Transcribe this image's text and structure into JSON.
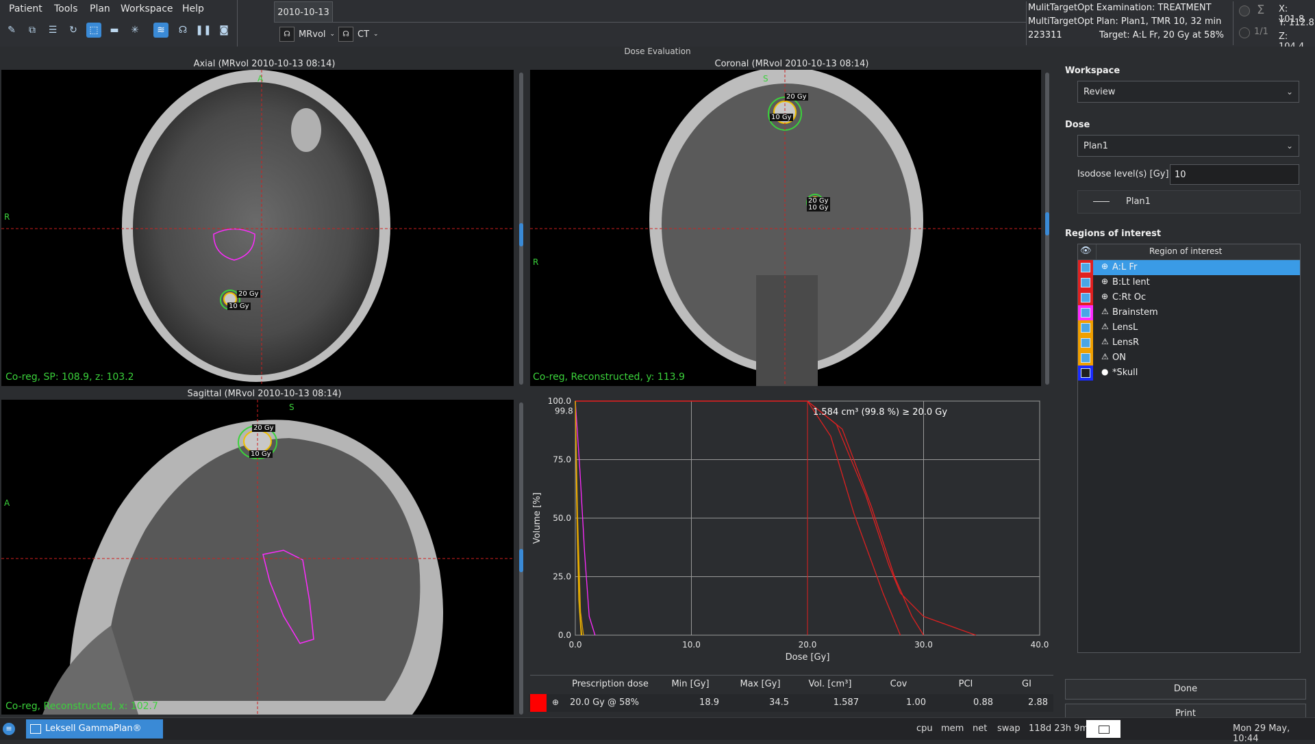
{
  "menu": [
    "Patient",
    "Tools",
    "Plan",
    "Workspace",
    "Help"
  ],
  "dataset": {
    "date_tab": "2010-10-13",
    "primary": "MRvol",
    "secondary": "CT"
  },
  "exam_info": {
    "line1": "MulitTargetOpt Examination: TREATMENT",
    "line2": "MultiTargetOpt Plan: Plan1, TMR 10, 32 min",
    "patient_id": "223311",
    "target": "Target: A:L Fr, 20 Gy at 58%"
  },
  "coords": {
    "x": "X: 101.8",
    "y": "Y: 112.8",
    "z": "Z: 104.4",
    "frames": "1/1"
  },
  "section_title": "Dose Evaluation",
  "views": {
    "axial": {
      "title": "Axial (MRvol 2010-10-13 08:14)",
      "status": "Co-reg, SP: 108.9, z: 103.2",
      "orient_left": "R",
      "orient_top": "A"
    },
    "coronal": {
      "title": "Coronal (MRvol 2010-10-13 08:14)",
      "status": "Co-reg, Reconstructed, y: 113.9",
      "orient_left": "R",
      "orient_top": "S"
    },
    "sagittal": {
      "title": "Sagittal (MRvol 2010-10-13 08:14)",
      "status": "Co-reg, Reconstructed, x: 102.7",
      "orient_left": "A",
      "orient_top": "S"
    },
    "iso_20": "20 Gy",
    "iso_10": "10 Gy"
  },
  "chart_data": {
    "type": "line",
    "xlabel": "Dose [Gy]",
    "ylabel": "Volume [%]",
    "xlim": [
      0,
      40
    ],
    "ylim": [
      0,
      100
    ],
    "x_ticks": [
      "0.0",
      "10.0",
      "20.0",
      "30.0",
      "40.0"
    ],
    "y_ticks": [
      "0.0",
      "25.0",
      "50.0",
      "75.0",
      "100.0"
    ],
    "extra_tick": "99.8",
    "annotation": "1.584 cm³ (99.8 %) ≥ 20.0 Gy",
    "grid": true,
    "series": [
      {
        "color": "#e02020",
        "x": [
          0,
          20.0,
          22.5,
          25.0,
          27.0,
          28.0,
          30.0,
          34.5
        ],
        "y": [
          100,
          100,
          90,
          60,
          30,
          18,
          8,
          0
        ]
      },
      {
        "color": "#e02020",
        "x": [
          0,
          20.0,
          23.0,
          25.5,
          27.5,
          29.0,
          30.0
        ],
        "y": [
          100,
          100,
          88,
          55,
          25,
          8,
          0
        ]
      },
      {
        "color": "#e02020",
        "x": [
          0,
          20.0,
          22.0,
          24.0,
          26.5,
          28.0
        ],
        "y": [
          100,
          100,
          85,
          52,
          18,
          0
        ]
      },
      {
        "color": "#ff2bff",
        "x": [
          0,
          0.4,
          0.8,
          1.2,
          1.7
        ],
        "y": [
          100,
          70,
          35,
          8,
          0
        ]
      },
      {
        "color": "#f0a000",
        "x": [
          0,
          0.1,
          0.3,
          0.5
        ],
        "y": [
          100,
          60,
          15,
          0
        ]
      },
      {
        "color": "#f0c000",
        "x": [
          0,
          0.15,
          0.35,
          0.55
        ],
        "y": [
          100,
          55,
          12,
          0
        ]
      },
      {
        "color": "#e0a000",
        "x": [
          0,
          0.2,
          0.45,
          0.7
        ],
        "y": [
          100,
          50,
          10,
          0
        ]
      }
    ],
    "vline_x": 20.0
  },
  "dose_table": {
    "headers": [
      "Prescription dose",
      "Min [Gy]",
      "Max [Gy]",
      "Vol. [cm³]",
      "Cov",
      "PCI",
      "GI"
    ],
    "row": [
      "20.0 Gy @ 58%",
      "18.9",
      "34.5",
      "1.587",
      "1.00",
      "0.88",
      "2.88"
    ],
    "row_color": "#ff0000"
  },
  "right_panel": {
    "workspace_label": "Workspace",
    "workspace_value": "Review",
    "dose_label": "Dose",
    "dose_value": "Plan1",
    "isodose_label": "Isodose level(s) [Gy]",
    "isodose_value": "10",
    "legend_plan": "Plan1",
    "roi_label": "Regions of interest",
    "roi_header": "Region of interest",
    "rois": [
      {
        "name": "A:L Fr",
        "color": "#e02020",
        "type": "target",
        "selected": true,
        "checked": true
      },
      {
        "name": "B:Lt lent",
        "color": "#e02020",
        "type": "target",
        "selected": false,
        "checked": true
      },
      {
        "name": "C:Rt Oc",
        "color": "#e02020",
        "type": "target",
        "selected": false,
        "checked": true
      },
      {
        "name": "Brainstem",
        "color": "#ff2bff",
        "type": "risk",
        "selected": false,
        "checked": true
      },
      {
        "name": "LensL",
        "color": "#f0a000",
        "type": "risk",
        "selected": false,
        "checked": true
      },
      {
        "name": "LensR",
        "color": "#f0a000",
        "type": "risk",
        "selected": false,
        "checked": true
      },
      {
        "name": "ON",
        "color": "#f0a000",
        "type": "risk",
        "selected": false,
        "checked": true
      },
      {
        "name": "*Skull",
        "color": "#1a2bff",
        "type": "skull",
        "selected": false,
        "checked": false
      }
    ],
    "done_label": "Done",
    "print_label": "Print"
  },
  "taskbar": {
    "app_name": "Leksell GammaPlan®",
    "cpu": "cpu",
    "mem": "mem",
    "net": "net",
    "swap": "swap",
    "uptime": "118d 23h 9m",
    "clock": "Mon 29 May, 10:44"
  }
}
